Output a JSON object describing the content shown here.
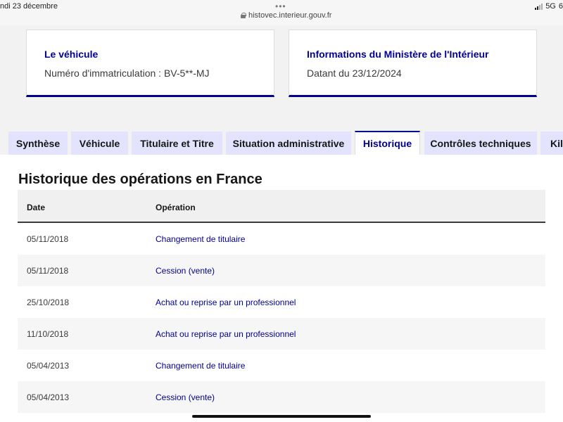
{
  "statusbar": {
    "time_date": "ndi 23 décembre",
    "dots": "•••",
    "url": "histovec.interieur.gouv.fr",
    "network": "5G",
    "battery": "6"
  },
  "cards": [
    {
      "title": "Le véhicule",
      "text": "Numéro d'immatriculation : BV-5**-MJ"
    },
    {
      "title": "Informations du Ministère de l'Intérieur",
      "text": "Datant du 23/12/2024"
    }
  ],
  "tabs": [
    {
      "label": "Synthèse"
    },
    {
      "label": "Véhicule"
    },
    {
      "label": "Titulaire et Titre"
    },
    {
      "label": "Situation administrative"
    },
    {
      "label": "Historique"
    },
    {
      "label": "Contrôles techniques"
    },
    {
      "label": "Kilo"
    }
  ],
  "active_tab": "Historique",
  "history": {
    "title": "Historique des opérations en France",
    "columns": {
      "date": "Date",
      "operation": "Opération"
    },
    "rows": [
      {
        "date": "05/11/2018",
        "operation": "Changement de titulaire"
      },
      {
        "date": "05/11/2018",
        "operation": "Cession (vente)"
      },
      {
        "date": "25/10/2018",
        "operation": "Achat ou reprise par un professionnel"
      },
      {
        "date": "11/10/2018",
        "operation": "Achat ou reprise par un professionnel"
      },
      {
        "date": "05/04/2013",
        "operation": "Changement de titulaire"
      },
      {
        "date": "05/04/2013",
        "operation": "Cession (vente)"
      }
    ]
  },
  "colors": {
    "accent": "#000091",
    "tab_bg": "#e3e3fd",
    "row_alt": "#f6f6f6"
  }
}
